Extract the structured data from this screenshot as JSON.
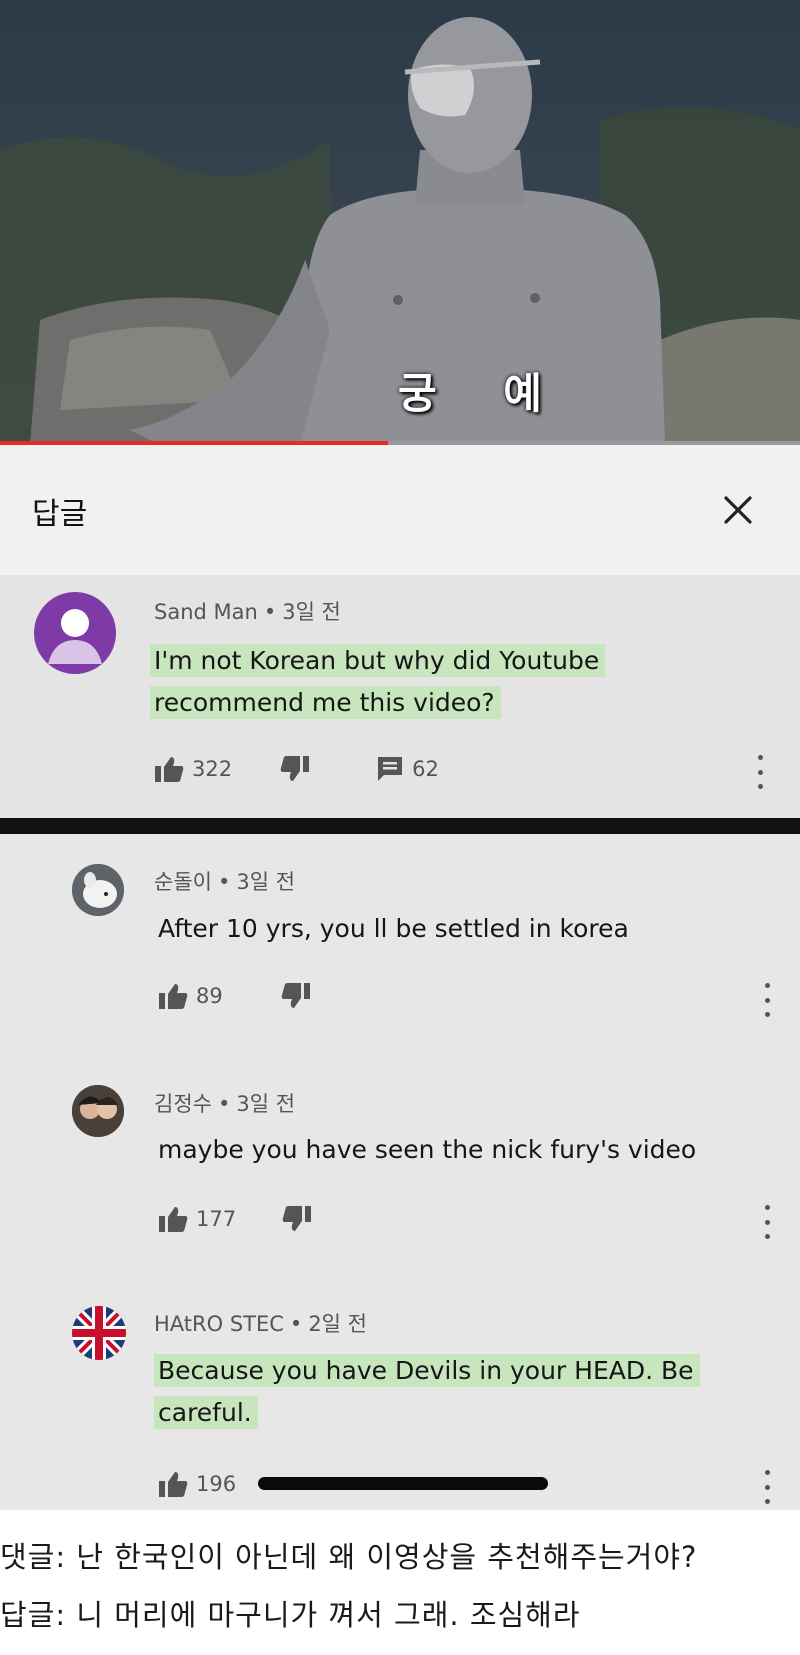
{
  "video": {
    "subtitle": "궁 예",
    "progress_fraction": 0.485
  },
  "reply_header": {
    "title": "답글",
    "close_icon": "close-icon"
  },
  "parent_comment": {
    "author": "Sand Man",
    "time": "3일 전",
    "lines": [
      "I'm not Korean but why did Youtube",
      "recommend me this video?"
    ],
    "likes": "322",
    "replies": "62",
    "avatar_color": "#7e3aa6"
  },
  "replies": [
    {
      "author": "순돌이",
      "time": "3일 전",
      "lines": [
        "After 10 yrs, you ll be settled in korea"
      ],
      "likes": "89"
    },
    {
      "author": "김정수",
      "time": "3일 전",
      "lines": [
        "maybe you have seen the nick fury's video"
      ],
      "likes": "177"
    },
    {
      "author": "HAtRO STEC",
      "time": "2일 전",
      "lines": [
        "Because you have Devils in your HEAD. Be",
        "careful."
      ],
      "likes": "196"
    }
  ],
  "caption": {
    "line1": "댓글: 난 한국인이 아닌데 왜 이영상을 추천해주는거야?",
    "line2": "답글: 니 머리에 마구니가 껴서 그래. 조심해라"
  },
  "colors": {
    "highlight": "#c7e6bd",
    "progress": "#e52d27",
    "panel": "#e4e4e4"
  }
}
